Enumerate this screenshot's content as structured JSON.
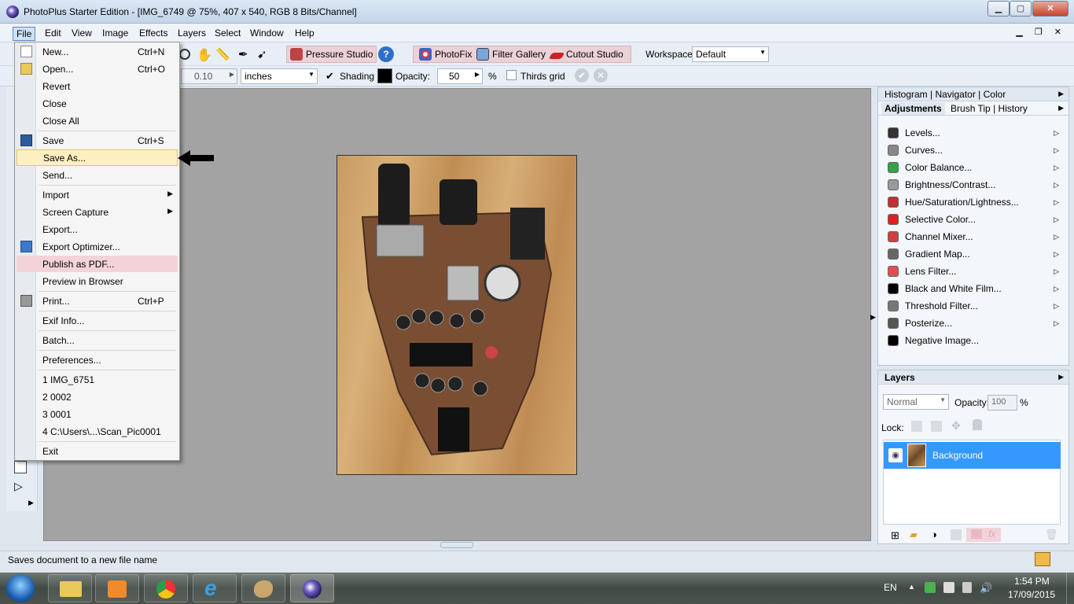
{
  "window": {
    "title": "PhotoPlus Starter Edition - [IMG_6749 @ 75%, 407 x 540, RGB 8 Bits/Channel]",
    "minimize": "▁",
    "maximize": "▢",
    "close": "✕"
  },
  "menubar": {
    "items": [
      "File",
      "Edit",
      "View",
      "Image",
      "Effects",
      "Layers",
      "Select",
      "Window",
      "Help"
    ],
    "mdi": "▁ ❐ ✕"
  },
  "toolbar1": {
    "pressure_studio": "Pressure Studio",
    "photofix": "PhotoFix",
    "filter_gallery": "Filter Gallery",
    "cutout_studio": "Cutout Studio",
    "workspace_label": "Workspace",
    "workspace_value": "Default"
  },
  "toolbar2": {
    "size_value": "0.10",
    "units_value": "inches",
    "shading_label": "Shading",
    "opacity_label": "Opacity:",
    "opacity_value": "50",
    "percent": "%",
    "thirds_grid_label": "Thirds grid"
  },
  "file_menu": {
    "new": {
      "label": "New...",
      "shortcut": "Ctrl+N"
    },
    "open": {
      "label": "Open...",
      "shortcut": "Ctrl+O"
    },
    "revert": "Revert",
    "close": "Close",
    "close_all": "Close All",
    "save": {
      "label": "Save",
      "shortcut": "Ctrl+S"
    },
    "save_as": "Save As...",
    "send": "Send...",
    "import": "Import",
    "screen_capture": "Screen Capture",
    "export": "Export...",
    "export_optimizer": "Export Optimizer...",
    "publish_pdf": "Publish as PDF...",
    "preview_browser": "Preview in Browser",
    "print": {
      "label": "Print...",
      "shortcut": "Ctrl+P"
    },
    "exif": "Exif Info...",
    "batch": "Batch...",
    "preferences": "Preferences...",
    "recent": [
      "1 IMG_6751",
      "2 0002",
      "3 0001",
      "4 C:\\Users\\...\\Scan_Pic0001"
    ],
    "exit": "Exit"
  },
  "panels": {
    "top_tabs": "Histogram | Navigator | Color",
    "adj_tabs": [
      "Adjustments",
      "Brush Tip",
      "History"
    ],
    "adjustments": [
      "Levels...",
      "Curves...",
      "Color Balance...",
      "Brightness/Contrast...",
      "Hue/Saturation/Lightness...",
      "Selective Color...",
      "Channel Mixer...",
      "Gradient Map...",
      "Lens Filter...",
      "Black and White Film...",
      "Threshold Filter...",
      "Posterize...",
      "Negative Image..."
    ],
    "adjustment_colors": [
      "#333333",
      "#888888",
      "#3aa04a",
      "#999999",
      "#c03030",
      "#e02020",
      "#d04040",
      "#666666",
      "#e05050",
      "#000000",
      "#777777",
      "#555555",
      "#000000"
    ]
  },
  "layers": {
    "title": "Layers",
    "blend_mode": "Normal",
    "opacity_label": "Opacity:",
    "opacity_value": "100",
    "percent": "%",
    "lock_label": "Lock:",
    "layer_name": "Background"
  },
  "status": {
    "text": "Saves document to a new file name"
  },
  "taskbar": {
    "lang": "EN",
    "time": "1:54 PM",
    "date": "17/09/2015"
  }
}
